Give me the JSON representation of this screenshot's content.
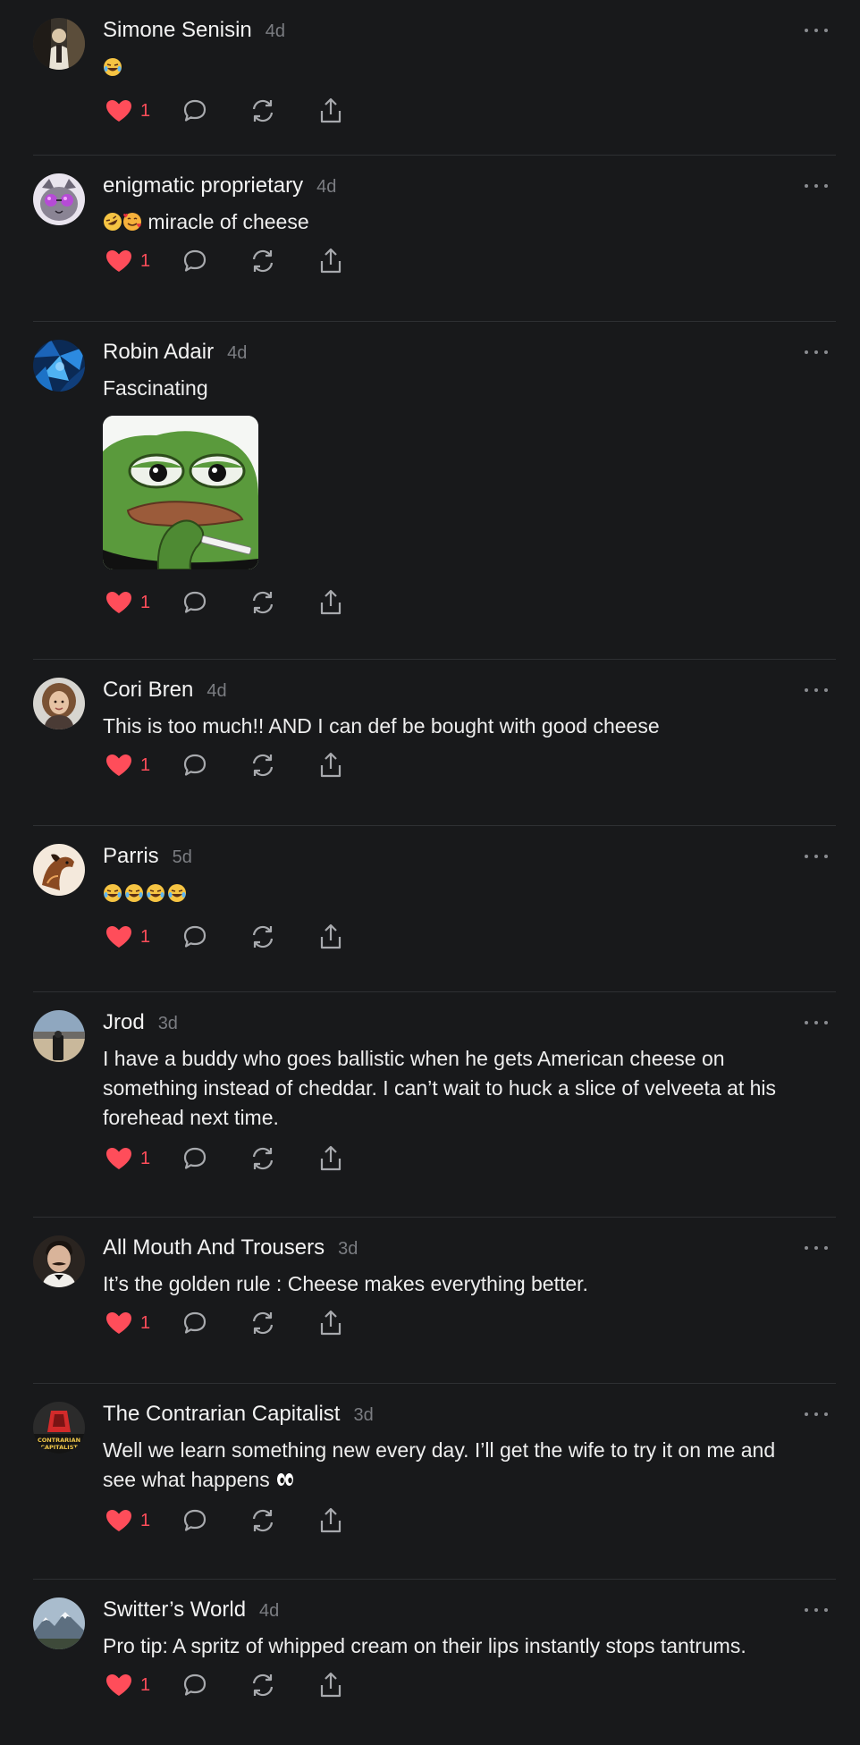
{
  "colors": {
    "background": "#18191b",
    "divider": "#2e3033",
    "like": "#ff4d5a",
    "muted": "#7b7d82"
  },
  "posts": [
    {
      "author": "Simone Senisin",
      "time": "4d",
      "avatar_icon": "man-portrait-avatar",
      "text": "",
      "emojis": [
        "joy"
      ],
      "likes": "1"
    },
    {
      "author": "enigmatic proprietary",
      "time": "4d",
      "avatar_icon": "cat-sunglasses-avatar",
      "text": "miracle of cheese",
      "emojis_before_text": [
        "rofl",
        "smiling-hearts"
      ],
      "likes": "1"
    },
    {
      "author": "Robin Adair",
      "time": "4d",
      "avatar_icon": "blue-crystal-avatar",
      "text": "Fascinating",
      "media": "pepe-frog-smoking-image",
      "likes": "1"
    },
    {
      "author": "Cori Bren",
      "time": "4d",
      "avatar_icon": "woman-curly-hair-avatar",
      "text": "This is too much!! AND I can def be bought with good cheese",
      "likes": "1"
    },
    {
      "author": "Parris",
      "time": "5d",
      "avatar_icon": "horse-avatar",
      "text": "",
      "emojis": [
        "joy",
        "joy",
        "joy",
        "joy"
      ],
      "likes": "1"
    },
    {
      "author": "Jrod",
      "time": "3d",
      "avatar_icon": "desert-road-avatar",
      "text": "I have a buddy who goes ballistic when he gets American cheese on\nsomething instead of cheddar. I can’t wait to huck a slice of velveeta at his\nforehead next time.",
      "likes": "1"
    },
    {
      "author": "All Mouth And Trousers",
      "time": "3d",
      "avatar_icon": "man-mustache-avatar",
      "text": "It’s the golden rule : Cheese makes everything better.",
      "likes": "1"
    },
    {
      "author": "The Contrarian Capitalist",
      "time": "3d",
      "avatar_icon": "contrarian-capitalist-logo-avatar",
      "avatar_logo_text": "CONTRARIAN CAPITALIST",
      "text": "Well we learn something new every day. I’ll get the wife to try it on me and\nsee what happens",
      "emojis_after_text": [
        "eyes"
      ],
      "likes": "1"
    },
    {
      "author": "Switter’s World",
      "time": "4d",
      "avatar_icon": "mountain-landscape-avatar",
      "text": "Pro tip: A spritz of whipped cream on their lips instantly stops tantrums.",
      "likes": "1"
    }
  ]
}
